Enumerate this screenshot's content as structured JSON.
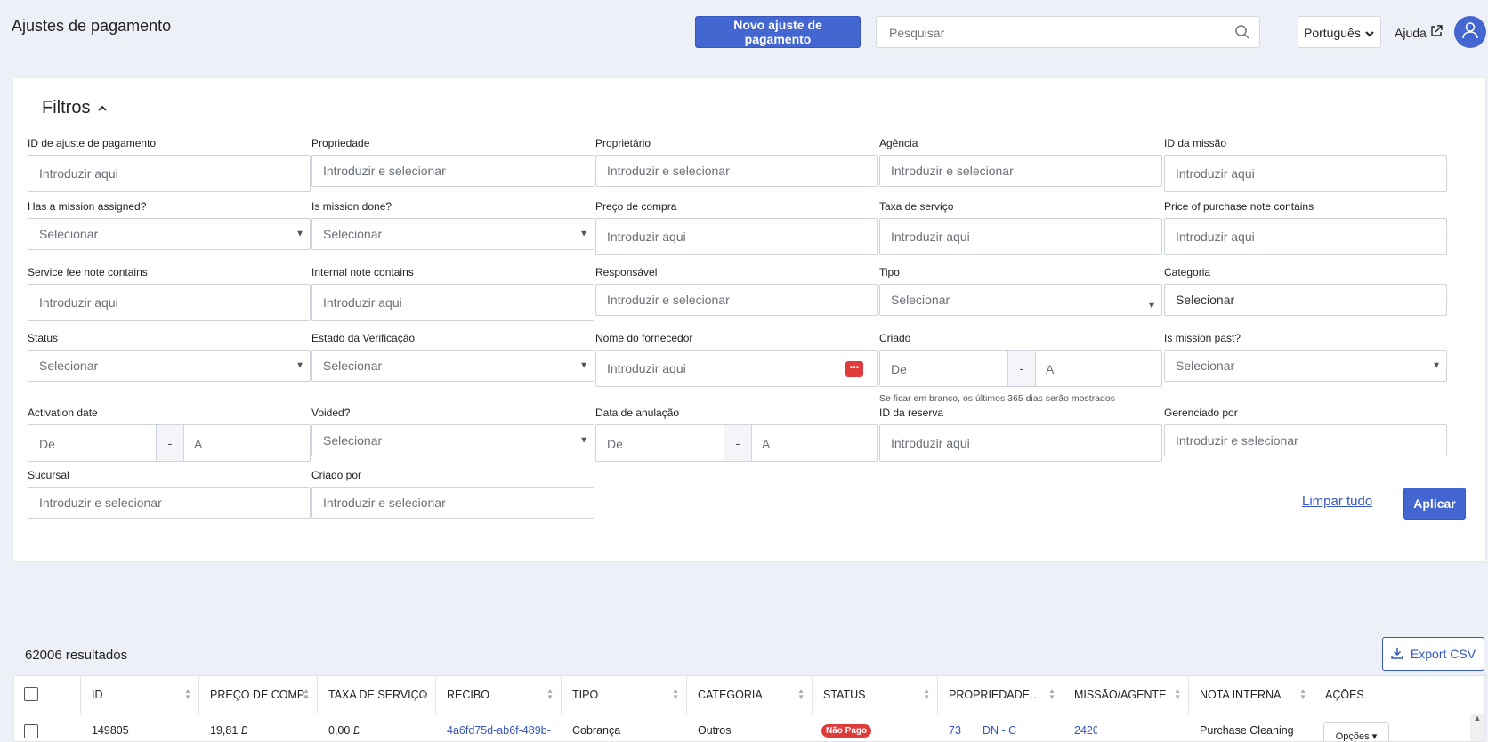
{
  "header": {
    "title": "Ajustes de pagamento",
    "new_button": "Novo ajuste de pagamento",
    "search_placeholder": "Pesquisar",
    "language": "Português",
    "help": "Ajuda"
  },
  "filters": {
    "title": "Filtros",
    "fields": {
      "payment_adjustment_id": {
        "label": "ID de ajuste de pagamento",
        "placeholder": "Introduzir aqui"
      },
      "property": {
        "label": "Propriedade",
        "placeholder": "Introduzir e selecionar"
      },
      "owner": {
        "label": "Proprietário",
        "placeholder": "Introduzir e selecionar"
      },
      "agency": {
        "label": "Agência",
        "placeholder": "Introduzir e selecionar"
      },
      "mission_id": {
        "label": "ID da missão",
        "placeholder": "Introduzir aqui"
      },
      "has_mission": {
        "label": "Has a mission assigned?",
        "placeholder": "Selecionar"
      },
      "mission_done": {
        "label": "Is mission done?",
        "placeholder": "Selecionar"
      },
      "purchase_price": {
        "label": "Preço de compra",
        "placeholder": "Introduzir aqui"
      },
      "service_fee": {
        "label": "Taxa de serviço",
        "placeholder": "Introduzir aqui"
      },
      "purchase_note": {
        "label": "Price of purchase note contains",
        "placeholder": "Introduzir aqui"
      },
      "service_fee_note": {
        "label": "Service fee note contains",
        "placeholder": "Introduzir aqui"
      },
      "internal_note": {
        "label": "Internal note contains",
        "placeholder": "Introduzir aqui"
      },
      "responsible": {
        "label": "Responsável",
        "placeholder": "Introduzir e selecionar"
      },
      "type": {
        "label": "Tipo",
        "placeholder": "Selecionar"
      },
      "category": {
        "label": "Categoria",
        "placeholder": "Selecionar"
      },
      "status": {
        "label": "Status",
        "placeholder": "Selecionar"
      },
      "verification_state": {
        "label": "Estado da Verificação",
        "placeholder": "Selecionar"
      },
      "supplier_name": {
        "label": "Nome do fornecedor",
        "placeholder": "Introduzir aqui"
      },
      "created": {
        "label": "Criado",
        "from": "De",
        "to": "A",
        "hint": "Se ficar em branco, os últimos 365 dias serão mostrados"
      },
      "mission_past": {
        "label": "Is mission past?",
        "placeholder": "Selecionar"
      },
      "activation_date": {
        "label": "Activation date",
        "from": "De",
        "to": "A"
      },
      "voided": {
        "label": "Voided?",
        "placeholder": "Selecionar"
      },
      "void_date": {
        "label": "Data de anulação",
        "from": "De",
        "to": "A"
      },
      "booking_id": {
        "label": "ID da reserva",
        "placeholder": "Introduzir aqui"
      },
      "managed_by": {
        "label": "Gerenciado por",
        "placeholder": "Introduzir e selecionar"
      },
      "branch": {
        "label": "Sucursal",
        "placeholder": "Introduzir e selecionar"
      },
      "created_by": {
        "label": "Criado por",
        "placeholder": "Introduzir e selecionar"
      }
    },
    "range_separator": "-",
    "clear_all": "Limpar tudo",
    "apply": "Aplicar"
  },
  "results": {
    "count": "62006 resultados",
    "export": "Export CSV"
  },
  "table": {
    "columns": [
      "ID",
      "PREÇO DE COMP...",
      "TAXA DE SERVIÇO",
      "RECIBO",
      "TIPO",
      "CATEGORIA",
      "STATUS",
      "PROPRIEDADE/P...",
      "MISSÃO/AGENTE",
      "NOTA INTERNA",
      "AÇÕES"
    ],
    "rows": [
      {
        "id": "149805",
        "purchase_price": "19,81 £",
        "service_fee": "0,00 £",
        "receipt": "4a6fd75d-ab6f-489b-",
        "type": "Cobrança",
        "category": "Outros",
        "status": "Não Pago",
        "property": "73",
        "property_code": "DN - C",
        "mission": "2420",
        "internal_note": "Purchase Cleaning",
        "actions": "Opções"
      }
    ]
  },
  "colors": {
    "primary": "#4466d1",
    "danger": "#e03b3b",
    "background": "#eef0f7"
  }
}
